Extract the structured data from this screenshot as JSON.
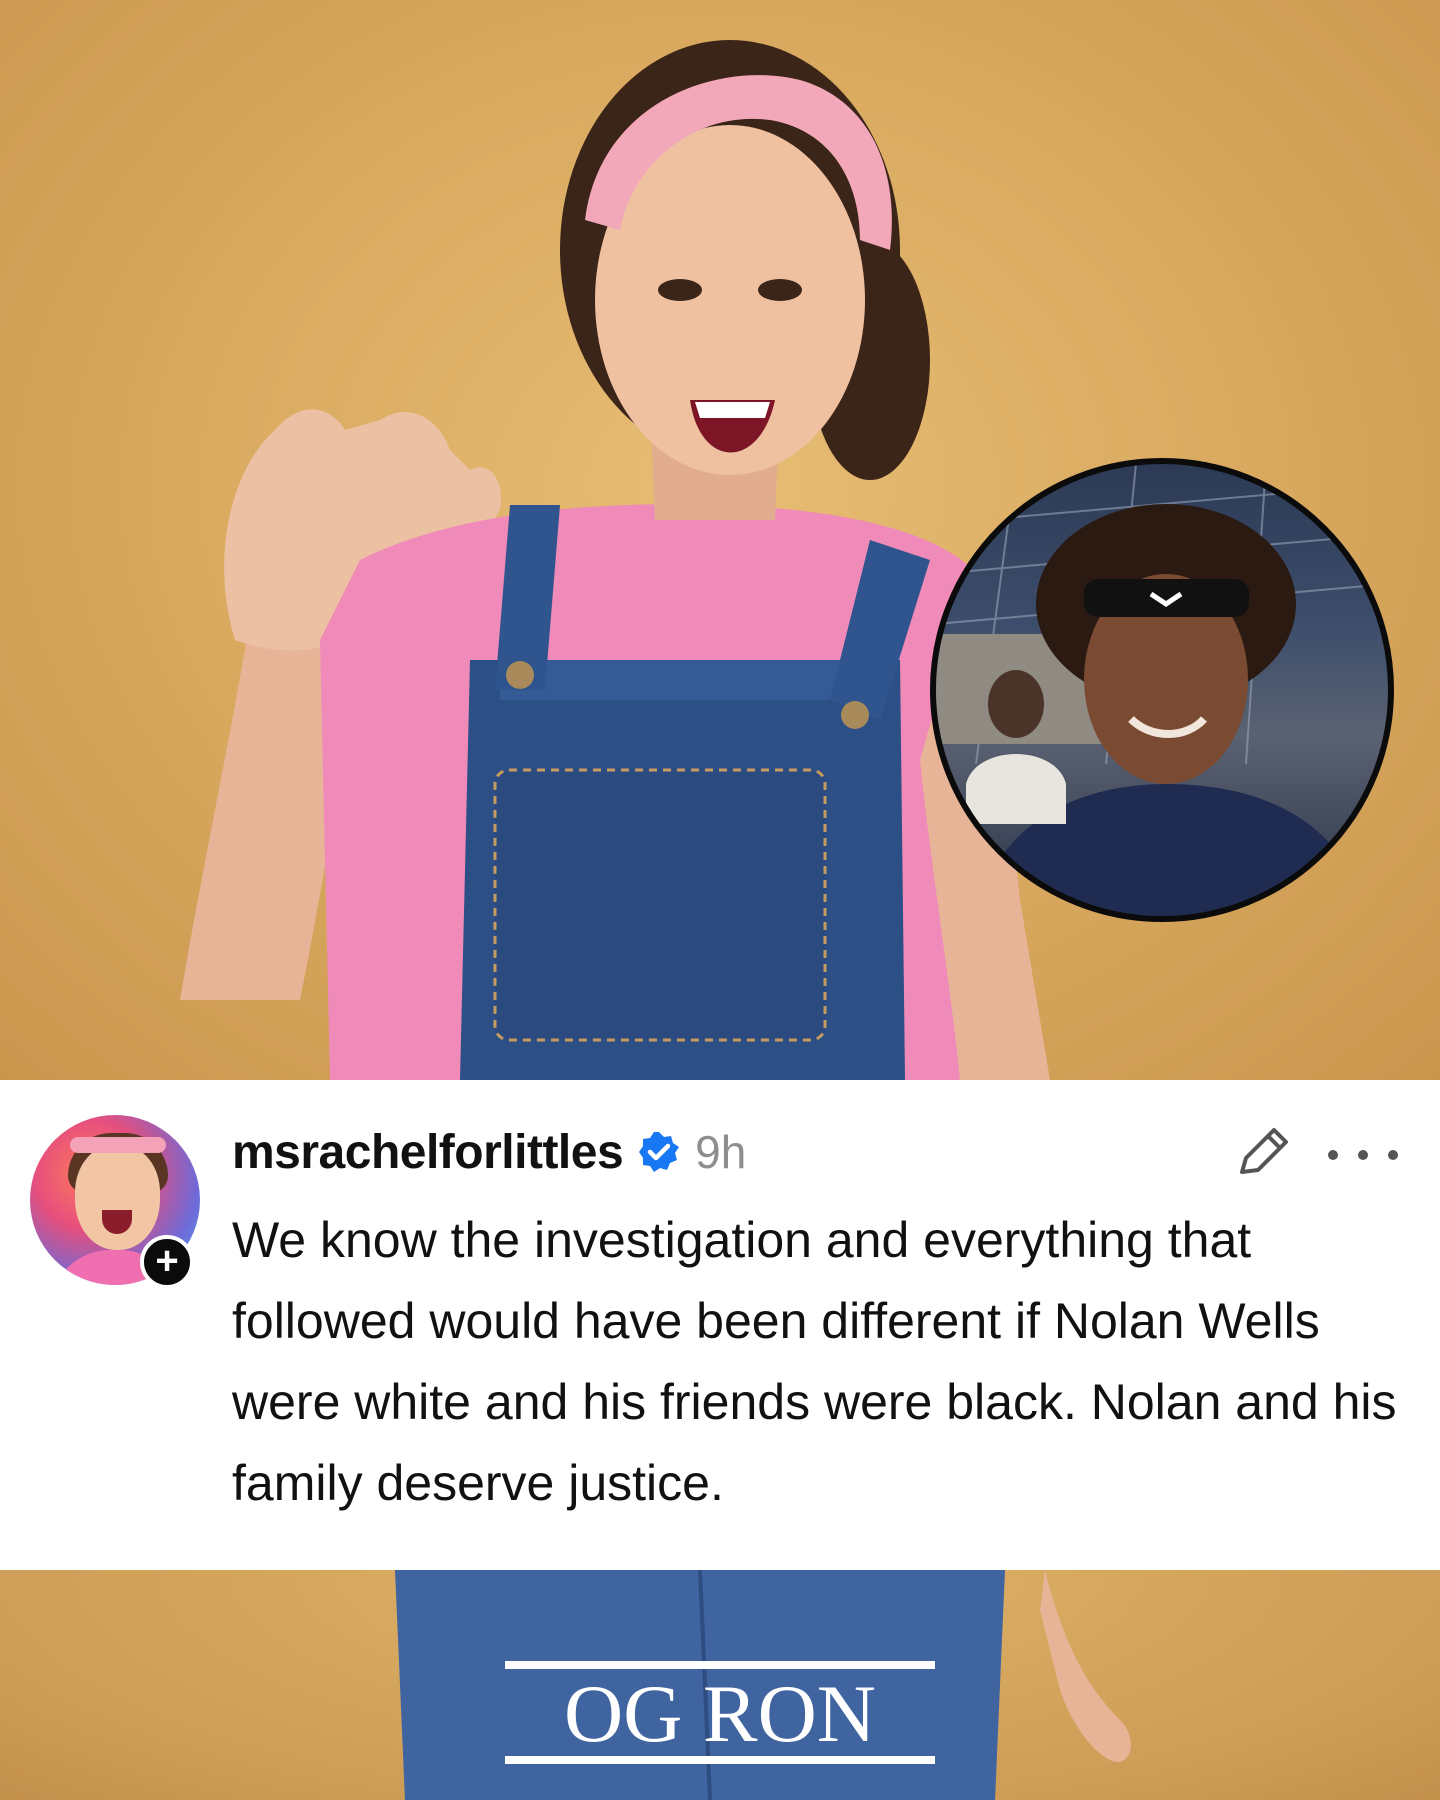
{
  "post": {
    "username": "msrachelforlittles",
    "timestamp": "9h",
    "text": "We know the investigation and everything that followed would have been different if Nolan Wells were white and his friends were black. Nolan and his family deserve justice.",
    "follow_symbol": "+"
  },
  "watermark": {
    "text": "OG RON"
  },
  "icons": {
    "verified": "verified-badge-icon",
    "edit": "pencil-icon",
    "more": "more-options-icon",
    "follow": "plus-icon"
  },
  "colors": {
    "background": "#d6a95f",
    "card": "#ffffff",
    "verified": "#1877f2",
    "text": "#111111",
    "timestamp": "#8e8e8e"
  }
}
